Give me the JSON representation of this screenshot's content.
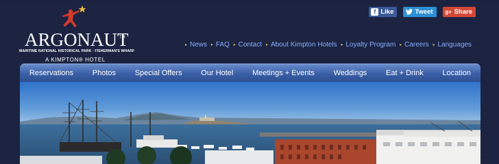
{
  "logo": {
    "name": "ARGONAUT",
    "tm": "TM",
    "tagline": "MARITIME NATIONAL HISTORICAL PARK · FISHERMAN'S WHARF",
    "subline": "A KIMPTON® HOTEL"
  },
  "social": [
    {
      "label": "Like",
      "icon": "facebook-icon"
    },
    {
      "label": "Tweet",
      "icon": "twitter-icon"
    },
    {
      "label": "Share",
      "icon": "google-plus-icon"
    }
  ],
  "utility_nav": [
    "News",
    "FAQ",
    "Contact",
    "About Kimpton Hotels",
    "Loyalty Program",
    "Careers",
    "Languages"
  ],
  "main_nav": [
    "Reservations",
    "Photos",
    "Special Offers",
    "Our Hotel",
    "Meetings + Events",
    "Weddings",
    "Eat + Drink",
    "Location"
  ],
  "colors": {
    "background": "#1a2240",
    "utility_link": "#87aefc",
    "nav_bar": "#3a5fa6",
    "facebook": "#3b5998",
    "twitter": "#2d8fd5",
    "google_plus": "#d34836"
  }
}
